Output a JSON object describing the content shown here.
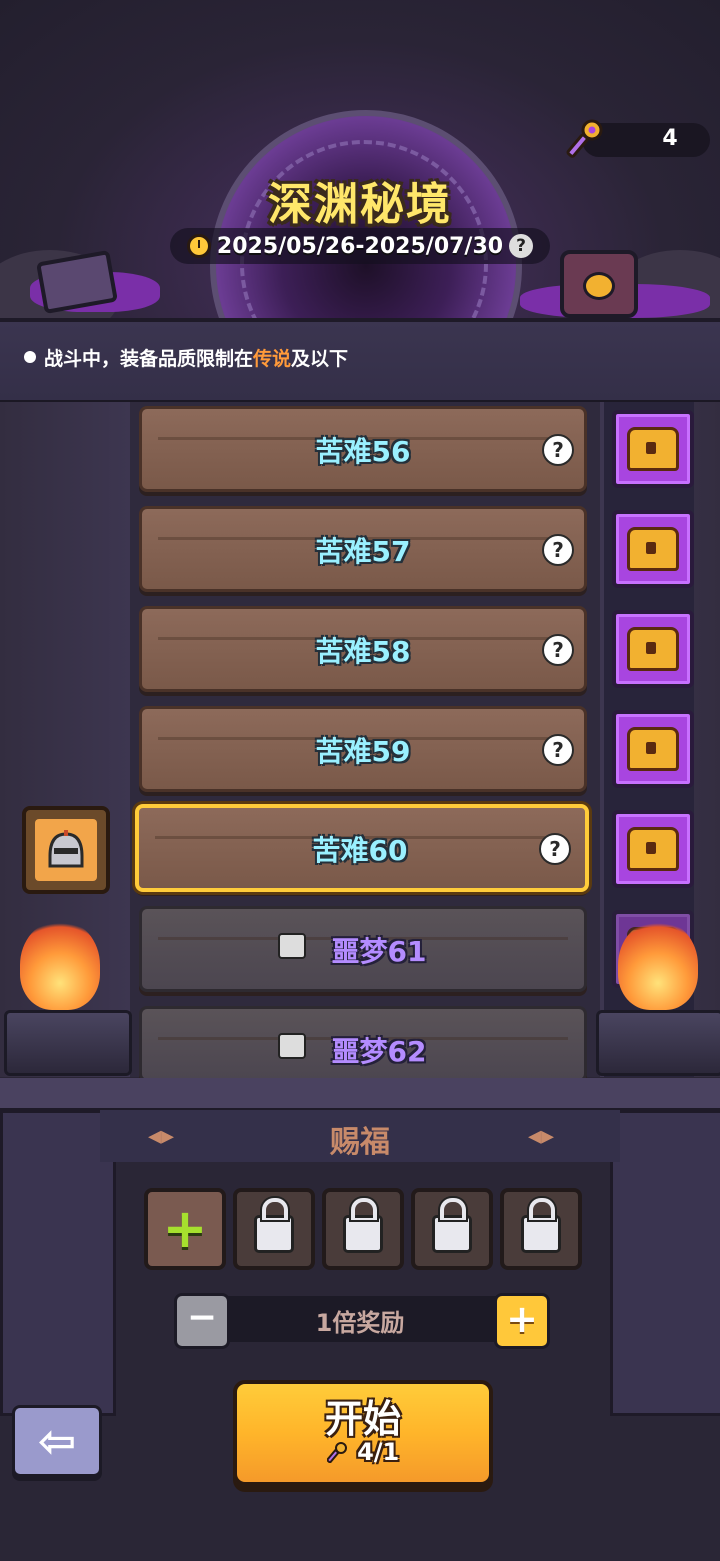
{
  "header": {
    "title": "深渊秘境",
    "date_range": "2025/05/26-2025/07/30",
    "help_symbol": "?",
    "key_count": "4",
    "icons": {
      "key": "key-icon",
      "timer": "stopwatch-icon"
    }
  },
  "notice": {
    "prefix": "战斗中，装备品质限制在",
    "highlight": "传说",
    "suffix": "及以下",
    "highlight_color": "#ff9a3a"
  },
  "levels": [
    {
      "label": "苦难56",
      "state": "unlocked"
    },
    {
      "label": "苦难57",
      "state": "unlocked"
    },
    {
      "label": "苦难58",
      "state": "unlocked"
    },
    {
      "label": "苦难59",
      "state": "unlocked"
    },
    {
      "label": "苦难60",
      "state": "selected"
    },
    {
      "label": "噩梦61",
      "state": "locked"
    },
    {
      "label": "噩梦62",
      "state": "locked"
    }
  ],
  "help_symbol": "?",
  "blessing": {
    "title": "赐福",
    "arrow_left": "◂▸",
    "arrow_right": "◂▸",
    "slots": [
      "add",
      "locked",
      "locked",
      "locked",
      "locked"
    ],
    "add_symbol": "+"
  },
  "multiplier": {
    "label": "1倍奖励",
    "minus": "−",
    "plus": "+"
  },
  "start": {
    "label": "开始",
    "cost": "4/1"
  },
  "back": {
    "symbol": "⇦"
  },
  "colors": {
    "title": "#ffe76a",
    "unlocked_level_text": "#9af0ff",
    "locked_level_text": "#b48cff",
    "selected_border": "#ffcc3a",
    "start_button": "#ffb52a",
    "chest": "#a845e0"
  }
}
